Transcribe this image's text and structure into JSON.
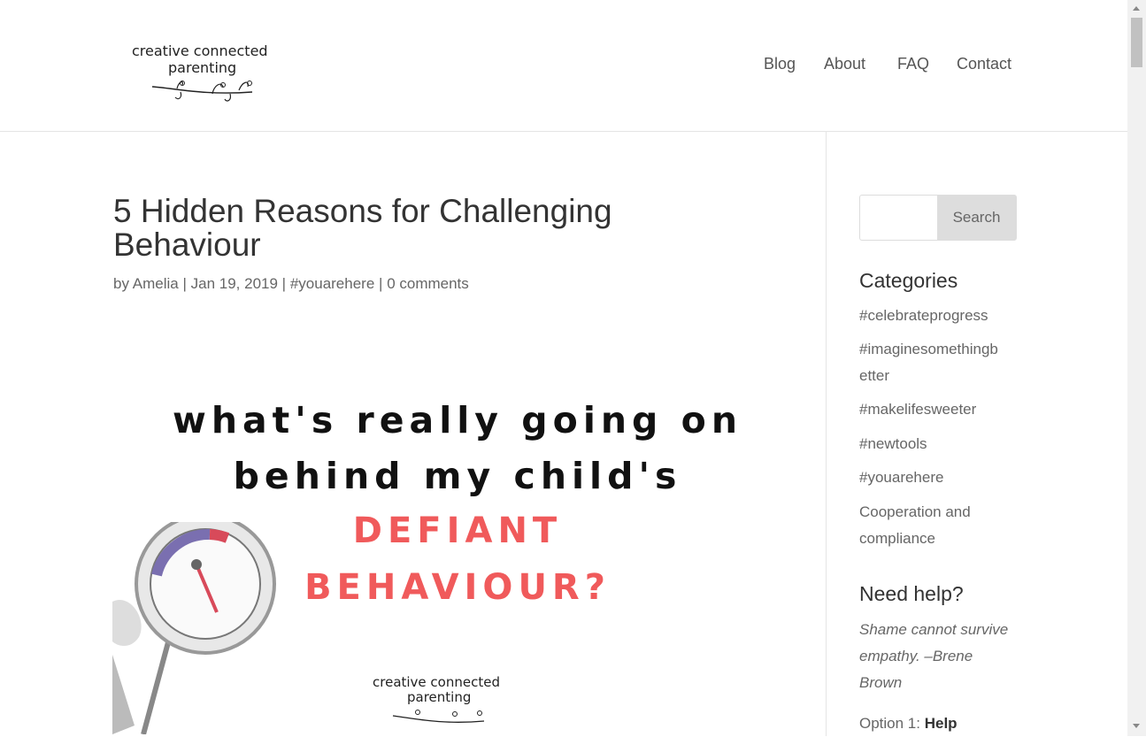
{
  "header": {
    "logo_line1": "creative connected",
    "logo_line2": "parenting",
    "nav": [
      "Blog",
      "About",
      "FAQ",
      "Contact"
    ]
  },
  "post": {
    "title": "5 Hidden Reasons for Challenging Behaviour",
    "meta": {
      "by": "by",
      "author": "Amelia",
      "date": "Jan 19, 2019",
      "category": "#youarehere",
      "comments": "0 comments",
      "sep": "|"
    },
    "feature_image": {
      "line1": "what's really going on",
      "line2": "behind my child's",
      "line3": "DEFIANT",
      "line4": "BEHAVIOUR?",
      "logo_line1": "creative connected",
      "logo_line2": "parenting"
    }
  },
  "sidebar": {
    "search_button": "Search",
    "search_placeholder": "",
    "categories_heading": "Categories",
    "categories": [
      "#celebrateprogress",
      "#imaginesomethingb etter",
      "#makelifesweeter",
      "#newtools",
      "#youarehere",
      "Cooperation and compliance"
    ],
    "help_heading": "Need help?",
    "quote": "Shame cannot survive empathy. –Brene Brown",
    "option_prefix": "Option 1: ",
    "option_bold": "Help"
  },
  "colors": {
    "accent_red": "#f05a5b",
    "text": "#666666",
    "heading": "#333333"
  }
}
